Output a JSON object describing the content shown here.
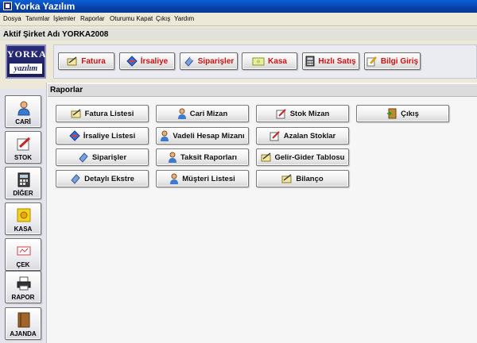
{
  "window": {
    "title": "Yorka Yazılım"
  },
  "menu": [
    "Dosya",
    "Tanımlar",
    "İşlemler",
    "Raporlar",
    "Oturumu Kapat",
    "Çıkış",
    "Yardım"
  ],
  "company": {
    "label": "Aktif Şirket Adı",
    "value": "YORKA2008"
  },
  "logo": {
    "line1": "YORKA",
    "line2": "yazılım"
  },
  "toolbar": {
    "fatura": "Fatura",
    "irsaliye": "İrsaliye",
    "siparisler": "Siparişler",
    "kasa": "Kasa",
    "hizli_satis": "Hızlı Satış",
    "bilgi_giris": "Bilgi Giriş"
  },
  "sidebar": {
    "cari": "CARİ",
    "stok": "STOK",
    "diger": "DİĞER",
    "kasa": "KASA",
    "cek": "ÇEK",
    "rapor": "RAPOR",
    "ajanda": "AJANDA"
  },
  "panel": {
    "title": "Raporlar"
  },
  "reports": {
    "fatura_listesi": "Fatura Listesi",
    "cari_mizan": "Cari Mizan",
    "stok_mizan": "Stok Mizan",
    "cikis": "Çıkış",
    "irsaliye_listesi": "İrsaliye Listesi",
    "vadeli_hesap_mizani": "Vadeli Hesap Mizanı",
    "azalan_stoklar": "Azalan Stoklar",
    "siparisler": "Siparişler",
    "taksit_raporlari": "Taksit Raporları",
    "gelir_gider_tablosu": "Gelir-Gider Tablosu",
    "detayli_ekstre": "Detaylı Ekstre",
    "musteri_listesi": "Müşteri Listesi",
    "bilanco": "Bilanço"
  }
}
